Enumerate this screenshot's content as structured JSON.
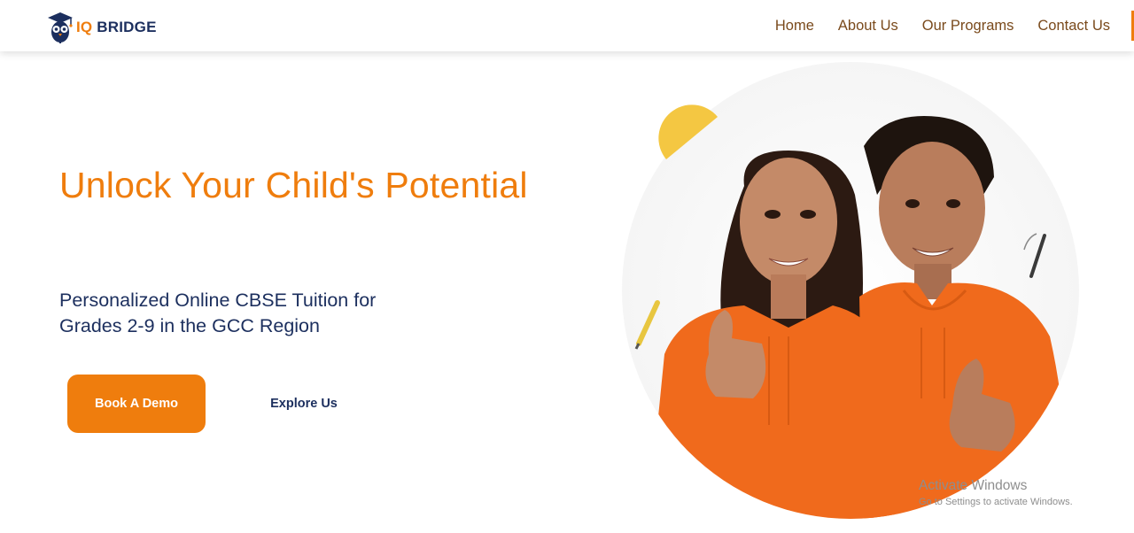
{
  "brand": {
    "iq": "IQ",
    "bridge": "BRIDGE"
  },
  "nav": {
    "items": [
      {
        "label": "Home"
      },
      {
        "label": "About Us"
      },
      {
        "label": "Our Programs"
      },
      {
        "label": "Contact Us"
      }
    ]
  },
  "hero": {
    "headline": "Unlock Your Child's Potential",
    "subheadline": "Personalized Online CBSE Tuition for Grades 2-9 in the GCC Region",
    "primary_cta": "Book A Demo",
    "secondary_cta": "Explore Us",
    "image_icon": "students-thumbs-up-illustration"
  },
  "watermark": {
    "title": "Activate Windows",
    "subtitle": "Go to Settings to activate Windows."
  },
  "colors": {
    "accent": "#ef7d0d",
    "navy": "#1c2f5e",
    "nav_text": "#7a4a1c",
    "shirt": "#f06a1c"
  }
}
